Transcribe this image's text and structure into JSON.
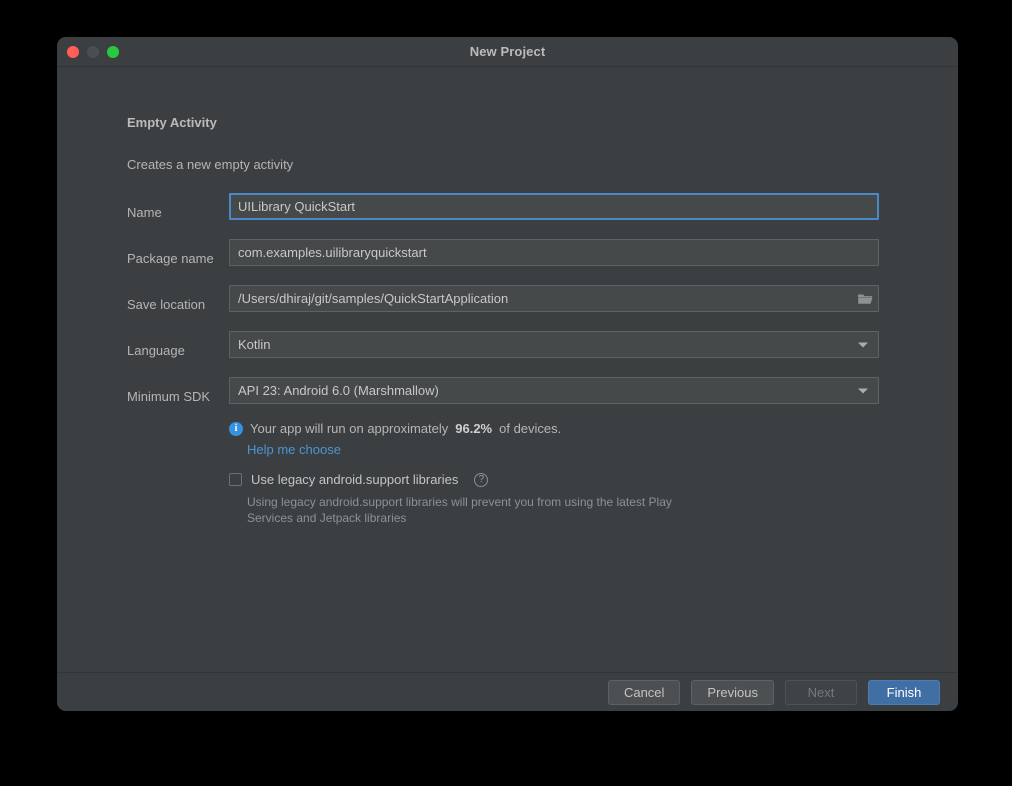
{
  "window": {
    "title": "New Project",
    "traffic_lights": [
      {
        "name": "close",
        "color": "#ff5f57"
      },
      {
        "name": "minimize",
        "color": "#4c4f51"
      },
      {
        "name": "maximize",
        "color": "#28c840"
      }
    ]
  },
  "header": {
    "title": "Empty Activity",
    "subtitle": "Creates a new empty activity"
  },
  "form": {
    "rows": [
      {
        "label": "Name",
        "value": "UILibrary QuickStart",
        "type": "text",
        "focused": true
      },
      {
        "label": "Package name",
        "value": "com.examples.uilibraryquickstart",
        "type": "text",
        "focused": false
      },
      {
        "label": "Save location",
        "value": "/Users/dhiraj/git/samples/QuickStartApplication",
        "type": "path",
        "focused": false,
        "icon": "folder-icon"
      },
      {
        "label": "Language",
        "value": "Kotlin",
        "type": "dropdown",
        "focused": false
      },
      {
        "label": "Minimum SDK",
        "value": "API 23: Android 6.0 (Marshmallow)",
        "type": "dropdown",
        "focused": false
      }
    ]
  },
  "info": {
    "icon": "info-icon",
    "text_before": "Your app will run on approximately",
    "percent": "96.2%",
    "text_after": "of devices.",
    "help_link": "Help me choose",
    "link_color": "#4a95d6",
    "icon_color": "#3592e0"
  },
  "legacy": {
    "checkbox_label": "Use legacy android.support libraries",
    "checked": false,
    "help_icon": "question-circle-icon",
    "description": "Using legacy android.support libraries will prevent you from using the latest Play Services and Jetpack libraries"
  },
  "footer": {
    "buttons": [
      {
        "label": "Cancel",
        "style": "normal",
        "enabled": true
      },
      {
        "label": "Previous",
        "style": "normal",
        "enabled": true
      },
      {
        "label": "Next",
        "style": "disabled",
        "enabled": false
      },
      {
        "label": "Finish",
        "style": "primary",
        "enabled": true
      }
    ],
    "primary_color": "#3f6fa5"
  }
}
